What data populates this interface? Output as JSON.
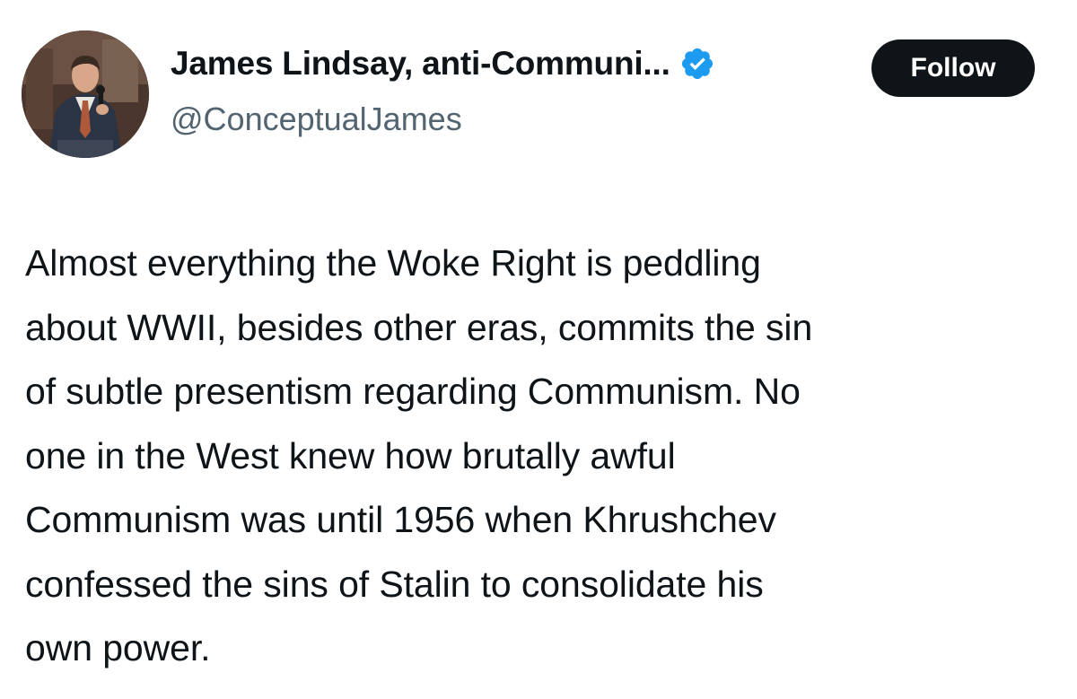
{
  "author": {
    "display_name": "James Lindsay, anti-Communi...",
    "handle": "@ConceptualJames",
    "verified": true,
    "verified_color": "#1d9bf0",
    "avatar_icon": "profile-photo"
  },
  "actions": {
    "follow_label": "Follow"
  },
  "tweet": {
    "lines": [
      "Almost everything the Woke Right is peddling",
      "about WWII, besides other eras, commits the sin",
      "of subtle presentism regarding Communism. No",
      "one in the West knew how brutally awful",
      "Communism was until 1956 when Khrushchev",
      "confessed the sins of Stalin to consolidate his",
      "own power."
    ]
  }
}
